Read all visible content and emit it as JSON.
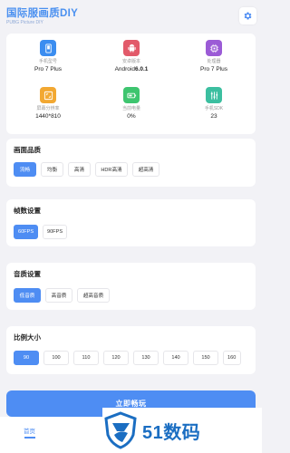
{
  "header": {
    "title": "国际服画质DIY",
    "subtitle": "PUBG Picture DIY",
    "settings_icon": "gear-icon"
  },
  "device_info": [
    {
      "label": "手机型号",
      "value": "Pro 7 Plus",
      "icon": "phone-icon",
      "color": "#3b8df0"
    },
    {
      "label": "安卓版本",
      "value_prefix": "Android",
      "value_bold": "6.0.1",
      "icon": "android-icon",
      "color": "#e25a6a"
    },
    {
      "label": "处理器",
      "value": "Pro 7 Plus",
      "icon": "chip-icon",
      "color": "#9b5bd6"
    },
    {
      "label": "屏幕分辨率",
      "value": "1440*810",
      "icon": "resolution-icon",
      "color": "#f2a832"
    },
    {
      "label": "当前电量",
      "value": "0%",
      "icon": "battery-icon",
      "color": "#3ec56f"
    },
    {
      "label": "手机SDK",
      "value": "23",
      "icon": "sliders-icon",
      "color": "#3cbfa0"
    }
  ],
  "sections": {
    "quality": {
      "title": "画面品质",
      "options": [
        "流畅",
        "均衡",
        "高清",
        "HDR高清",
        "超高清"
      ],
      "selected": 0
    },
    "fps": {
      "title": "帧数设置",
      "options": [
        "60FPS",
        "90FPS"
      ],
      "selected": 0
    },
    "audio": {
      "title": "音质设置",
      "options": [
        "低音质",
        "高音质",
        "超高音质"
      ],
      "selected": 0
    },
    "ratio": {
      "title": "比例大小",
      "options": [
        "90",
        "100",
        "110",
        "120",
        "130",
        "140",
        "150",
        "160"
      ],
      "selected": 0
    }
  },
  "start_button": "立即畅玩",
  "tabbar": {
    "home_label": "首页"
  },
  "watermark": {
    "text": "51数码"
  }
}
